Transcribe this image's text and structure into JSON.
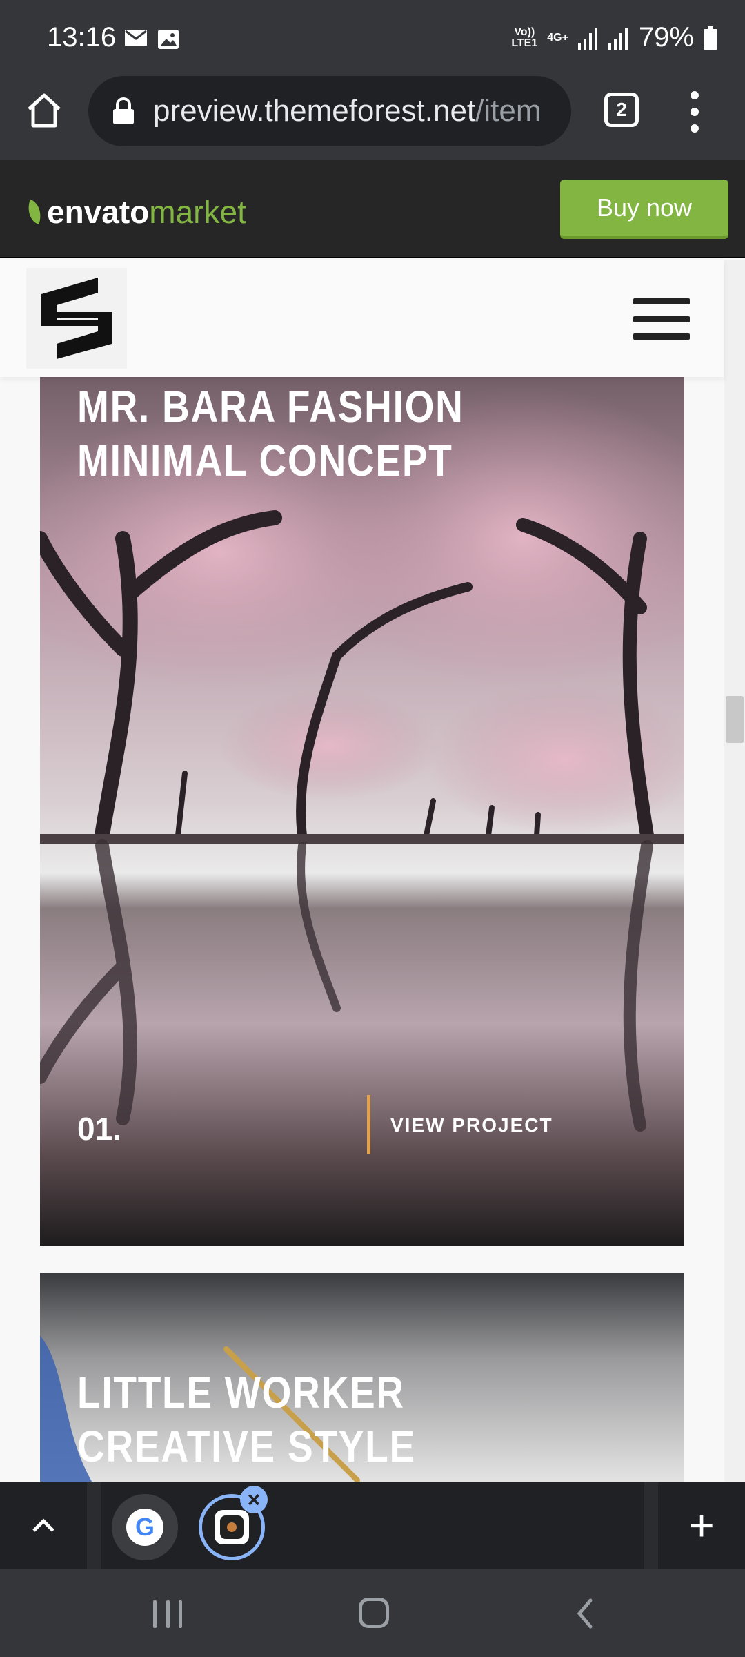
{
  "status_bar": {
    "time": "13:16",
    "network_top": "Vo))",
    "network_bottom": "LTE1",
    "net_type": "4G+",
    "battery": "79%",
    "icons": [
      "mail-icon",
      "image-icon",
      "signal-icon",
      "battery-icon"
    ]
  },
  "browser": {
    "url_main": "preview.themeforest.net",
    "url_rest": "/item",
    "tab_count": "2"
  },
  "envato": {
    "logo_word1": "envato",
    "logo_word2": "market",
    "buy_label": "Buy now",
    "accent": "#82b541"
  },
  "site": {
    "menu_icon": "hamburger-icon",
    "logo_icon": "s-logo-icon"
  },
  "projects": [
    {
      "title_line1": "MR. BARA FASHION",
      "title_line2": "MINIMAL CONCEPT",
      "number": "01.",
      "link_label": "VIEW PROJECT",
      "accent": "#e3a24b"
    },
    {
      "title_line1": "LITTLE WORKER",
      "title_line2": "CREATIVE STYLE"
    }
  ],
  "tab_strip": {
    "google_glyph": "G",
    "close_glyph": "×",
    "new_tab_glyph": "+"
  }
}
